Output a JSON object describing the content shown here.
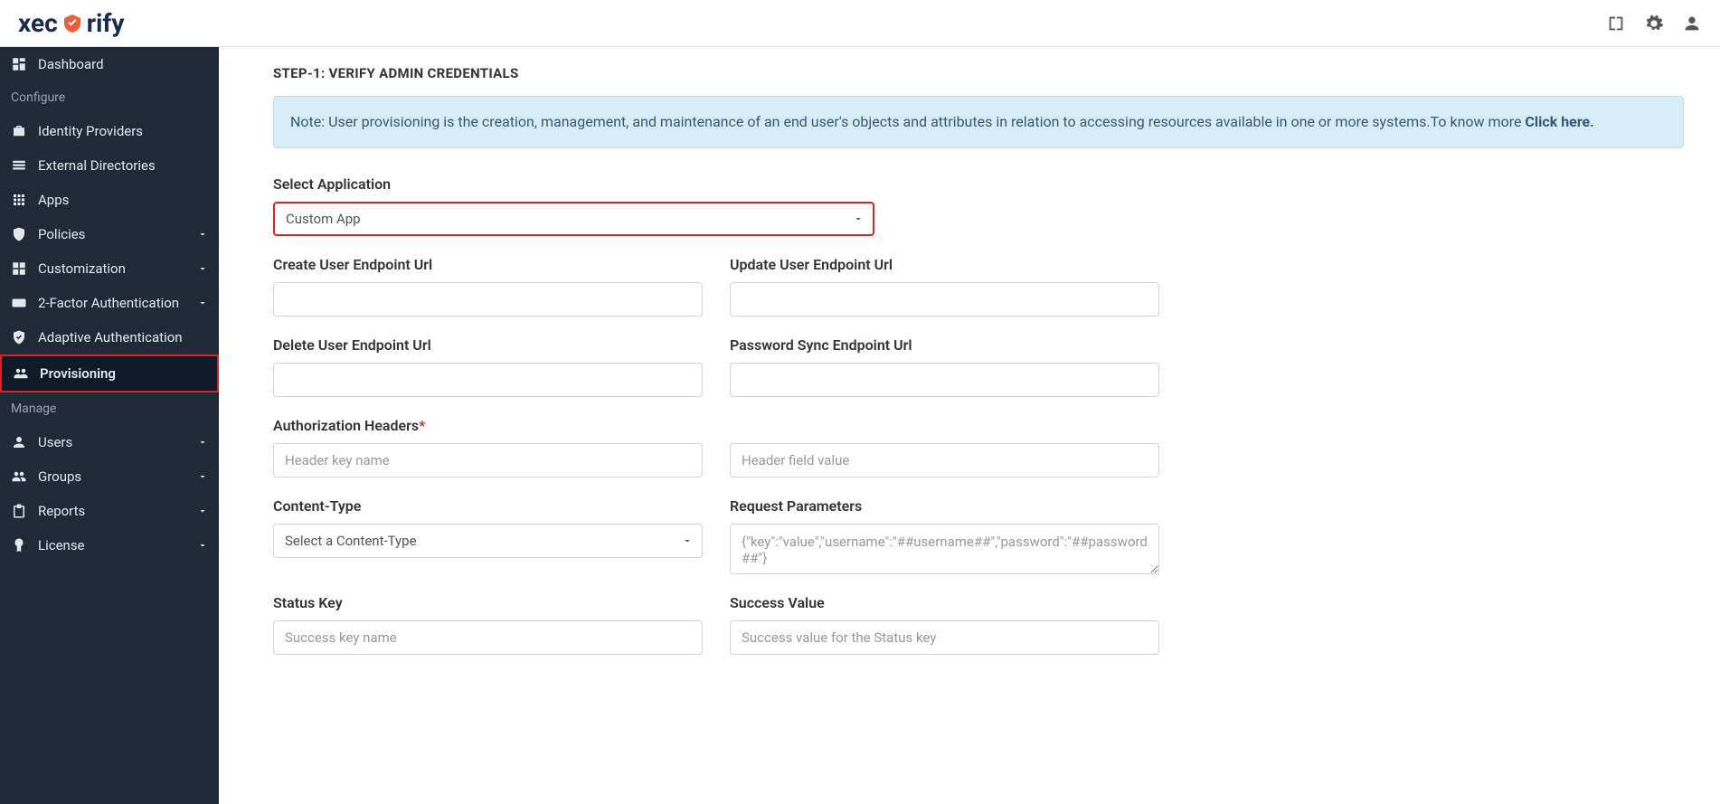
{
  "brand": {
    "text_left": "xec",
    "text_right": "rify"
  },
  "sidebar": {
    "items": [
      {
        "label": "Dashboard"
      },
      {
        "label": "Identity Providers"
      },
      {
        "label": "External Directories"
      },
      {
        "label": "Apps"
      },
      {
        "label": "Policies"
      },
      {
        "label": "Customization"
      },
      {
        "label": "2-Factor Authentication"
      },
      {
        "label": "Adaptive Authentication"
      },
      {
        "label": "Provisioning"
      },
      {
        "label": "Users"
      },
      {
        "label": "Groups"
      },
      {
        "label": "Reports"
      },
      {
        "label": "License"
      }
    ],
    "section_configure": "Configure",
    "section_manage": "Manage"
  },
  "step_title": "STEP-1: VERIFY ADMIN CREDENTIALS",
  "note": {
    "prefix": "Note: User provisioning is the creation, management, and maintenance of an end user's objects and attributes in relation to accessing resources available in one or more systems.To know more ",
    "link": "Click here."
  },
  "form": {
    "select_app_label": "Select Application",
    "select_app_value": "Custom App",
    "create_url_label": "Create User Endpoint Url",
    "update_url_label": "Update User Endpoint Url",
    "delete_url_label": "Delete User Endpoint Url",
    "password_url_label": "Password Sync Endpoint Url",
    "auth_headers_label": "Authorization Headers",
    "header_key_placeholder": "Header key name",
    "header_value_placeholder": "Header field value",
    "content_type_label": "Content-Type",
    "content_type_value": "Select a Content-Type",
    "request_params_label": "Request Parameters",
    "request_params_placeholder": "{\"key\":\"value\",\"username\":\"##username##\",\"password\":\"##password##\"}",
    "status_key_label": "Status Key",
    "status_key_placeholder": "Success key name",
    "success_value_label": "Success Value",
    "success_value_placeholder": "Success value for the Status key"
  }
}
